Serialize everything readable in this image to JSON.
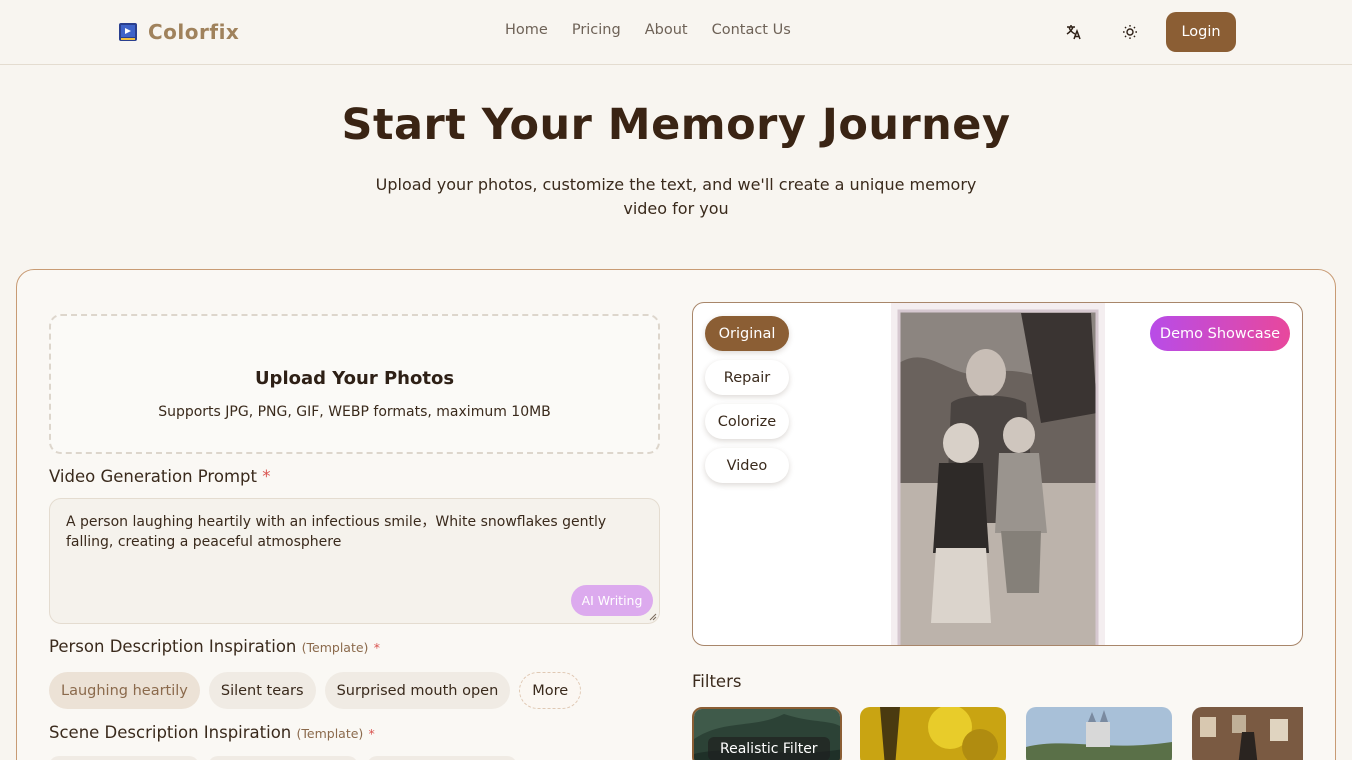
{
  "header": {
    "brand": "Colorfix",
    "nav": [
      "Home",
      "Pricing",
      "About",
      "Contact Us"
    ],
    "login": "Login"
  },
  "hero": {
    "title": "Start Your Memory Journey",
    "subtitle": "Upload your photos, customize the text, and we'll create a unique memory video for you"
  },
  "upload": {
    "title": "Upload Your Photos",
    "formats": "Supports JPG, PNG, GIF, WEBP formats, maximum 10MB"
  },
  "prompt": {
    "label": "Video Generation Prompt",
    "required": "*",
    "value": "A person laughing heartily with an infectious smile，White snowflakes gently falling, creating a peaceful atmosphere",
    "ai_button": "AI Writing"
  },
  "person_inspiration": {
    "label": "Person Description Inspiration",
    "template": "(Template)",
    "required": "*",
    "chips": [
      "Laughing heartily",
      "Silent tears",
      "Surprised mouth open",
      "More"
    ],
    "selected": "Laughing heartily"
  },
  "scene_inspiration": {
    "label": "Scene Description Inspiration",
    "template": "(Template)",
    "required": "*"
  },
  "preview": {
    "modes": [
      "Original",
      "Repair",
      "Colorize",
      "Video"
    ],
    "active_mode": "Original",
    "demo": "Demo Showcase"
  },
  "filters": {
    "label": "Filters",
    "items": [
      "Realistic Filter",
      "",
      "",
      ""
    ],
    "selected": "Realistic Filter"
  },
  "colors": {
    "accent": "#8b5e34",
    "brand": "#a0825c",
    "demo_gradient": [
      "#b84ce8",
      "#e8489c"
    ]
  }
}
